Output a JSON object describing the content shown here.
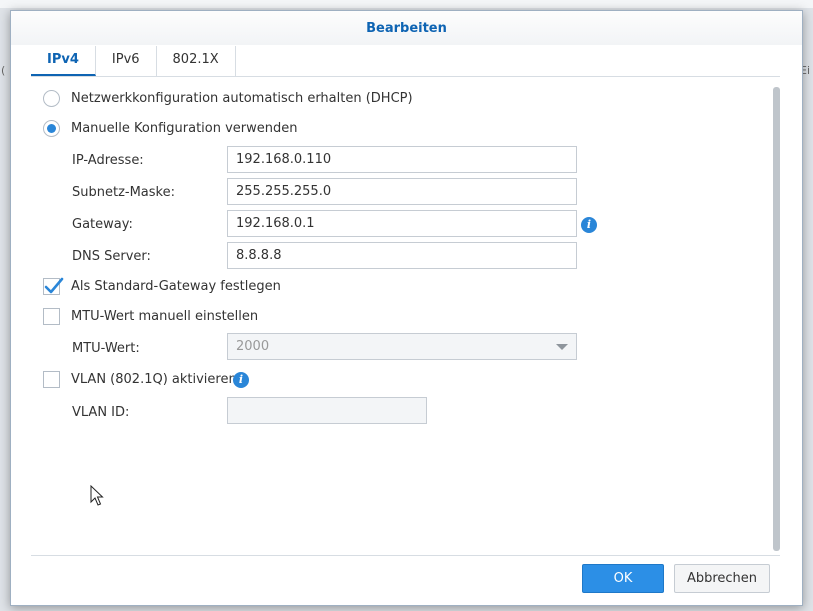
{
  "dialog": {
    "title": "Bearbeiten"
  },
  "tabs": [
    {
      "label": "IPv4",
      "active": true
    },
    {
      "label": "IPv6",
      "active": false
    },
    {
      "label": "802.1X",
      "active": false
    }
  ],
  "options": {
    "dhcp_label": "Netzwerkkonfiguration automatisch erhalten (DHCP)",
    "dhcp_selected": false,
    "manual_label": "Manuelle Konfiguration verwenden",
    "manual_selected": true
  },
  "fields": {
    "ip_label": "IP-Adresse:",
    "ip_value": "192.168.0.110",
    "subnet_label": "Subnetz-Maske:",
    "subnet_value": "255.255.255.0",
    "gateway_label": "Gateway:",
    "gateway_value": "192.168.0.1",
    "dns_label": "DNS Server:",
    "dns_value": "8.8.8.8"
  },
  "default_gateway": {
    "label": "Als Standard-Gateway festlegen",
    "checked": true
  },
  "mtu": {
    "checkbox_label": "MTU-Wert manuell einstellen",
    "checked": false,
    "field_label": "MTU-Wert:",
    "value": "2000"
  },
  "vlan": {
    "checkbox_label": "VLAN (802.1Q) aktivieren",
    "checked": false,
    "field_label": "VLAN ID:",
    "value": ""
  },
  "buttons": {
    "ok": "OK",
    "cancel": "Abbrechen"
  },
  "background": {
    "edge_glyph_left": "(",
    "edge_glyph_right": "Ei"
  },
  "colors": {
    "accent": "#0e64b3",
    "primary_button": "#2c8fe6",
    "info_icon": "#2a86d8"
  },
  "icons": {
    "info": "info-icon",
    "checkmark": "checkmark-icon",
    "dropdown": "chevron-down-icon",
    "cursor": "mouse-cursor-icon"
  }
}
